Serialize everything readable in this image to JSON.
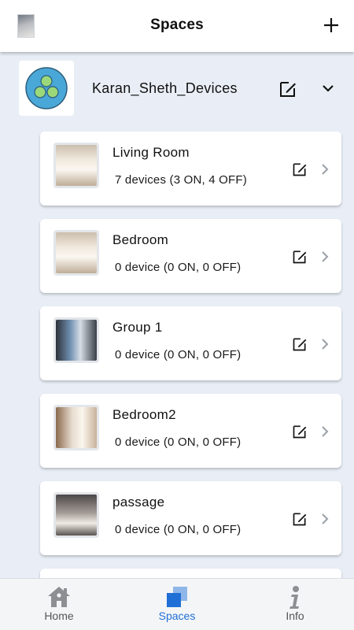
{
  "header": {
    "title": "Spaces"
  },
  "group": {
    "name": "Karan_Sheth_Devices"
  },
  "spaces": [
    {
      "name": "Living Room",
      "status": "7 devices (3 ON, 4 OFF)"
    },
    {
      "name": "Bedroom",
      "status": "0 device (0 ON, 0 OFF)"
    },
    {
      "name": "Group 1",
      "status": "0 device (0 ON, 0 OFF)"
    },
    {
      "name": "Bedroom2",
      "status": "0 device (0 ON, 0 OFF)"
    },
    {
      "name": "passage",
      "status": "0 device (0 ON, 0 OFF)"
    }
  ],
  "nav": {
    "home": "Home",
    "spaces": "Spaces",
    "info": "Info"
  },
  "colors": {
    "accent": "#1f6fd6",
    "background": "#e9eef6",
    "logo_fill": "#4aa8d8",
    "logo_dots": "#9ad87a"
  },
  "icons": [
    "add-icon",
    "edit-icon",
    "chevron-down-icon",
    "chevron-right-icon",
    "home-icon",
    "spaces-icon",
    "info-icon"
  ]
}
